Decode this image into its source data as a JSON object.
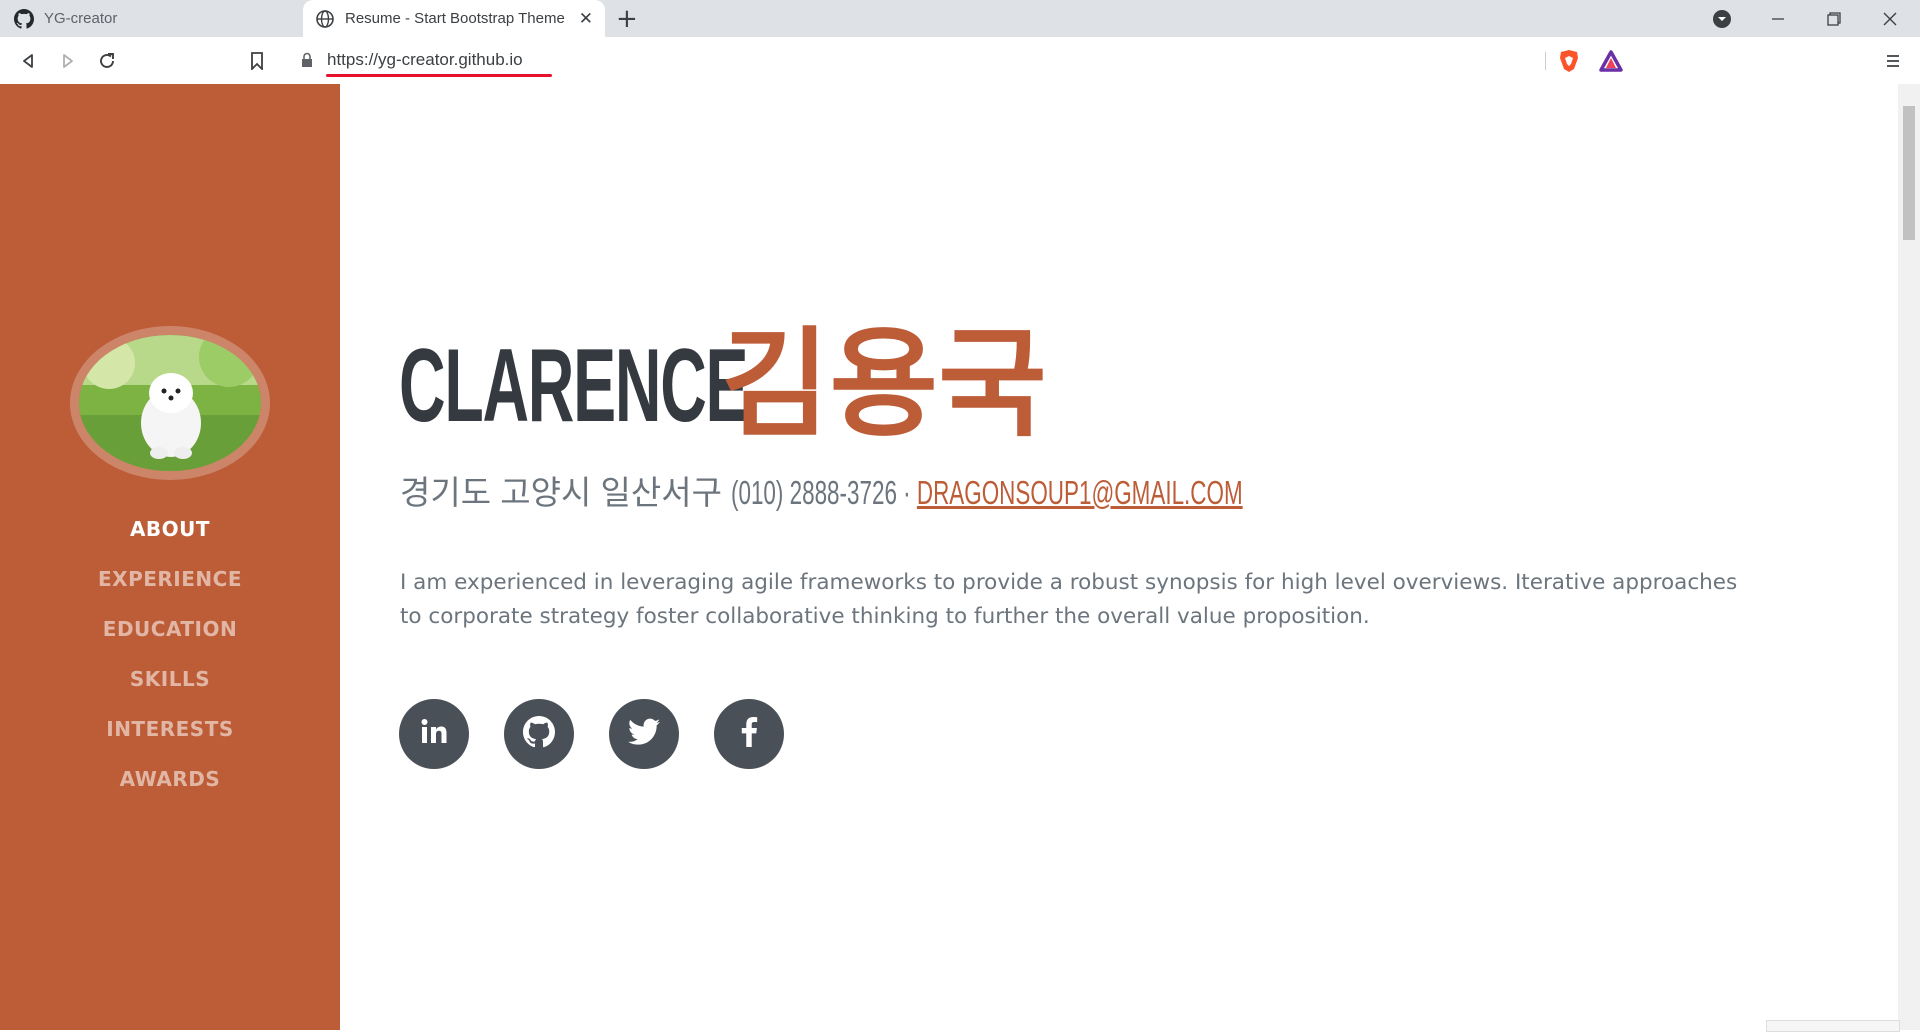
{
  "browser": {
    "tabs": [
      {
        "title": "YG-creator",
        "icon": "github-icon",
        "active": false
      },
      {
        "title": "Resume - Start Bootstrap Theme",
        "icon": "globe-icon",
        "active": true
      }
    ],
    "url": "https://yg-creator.github.io"
  },
  "sidebar": {
    "avatar_alt": "profile-photo-white-puppy",
    "items": [
      {
        "label": "ABOUT",
        "active": true
      },
      {
        "label": "EXPERIENCE",
        "active": false
      },
      {
        "label": "EDUCATION",
        "active": false
      },
      {
        "label": "SKILLS",
        "active": false
      },
      {
        "label": "INTERESTS",
        "active": false
      },
      {
        "label": "AWARDS",
        "active": false
      }
    ]
  },
  "about": {
    "first_name": "CLARENCE",
    "last_name": "김용국",
    "address": "경기도 고양시 일산서구",
    "phone": "(010) 2888-3726 ·",
    "email": "DRAGONSOUP1@GMAIL.COM",
    "lead": "I am experienced in leveraging agile frameworks to provide a robust synopsis for high level overviews. Iterative approaches to corporate strategy foster collaborative thinking to further the overall value proposition.",
    "social": [
      "linkedin-icon",
      "github-icon",
      "twitter-icon",
      "facebook-icon"
    ]
  },
  "colors": {
    "primary": "#bd5d38",
    "heading": "#343a40",
    "text": "#6c757d",
    "social_bg": "#495057"
  }
}
